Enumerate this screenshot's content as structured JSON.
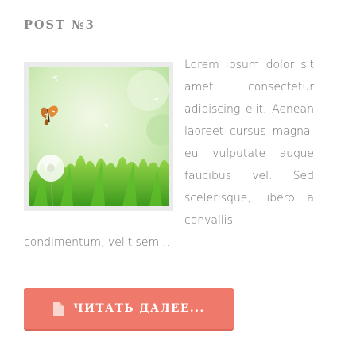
{
  "post": {
    "title": "POST №3",
    "excerpt": "Lorem ipsum dolor sit amet, consectetur adipiscing elit. Aenean laoreet cursus magna, eu vulputate augue faucibus vel. Sed scelerisque, libero a convallis condimentum, velit sem…",
    "thumbnail": {
      "subject": "butterfly and dandelion over green grass"
    },
    "read_more": {
      "label": "ЧИТАТЬ ДАЛЕЕ...",
      "icon": "document-icon"
    }
  },
  "colors": {
    "title": "#8a8a8a",
    "text": "#6f6f6f",
    "button": "#ef7a6b",
    "button_text": "#ffffff",
    "thumb_frame": "#ebebeb"
  }
}
